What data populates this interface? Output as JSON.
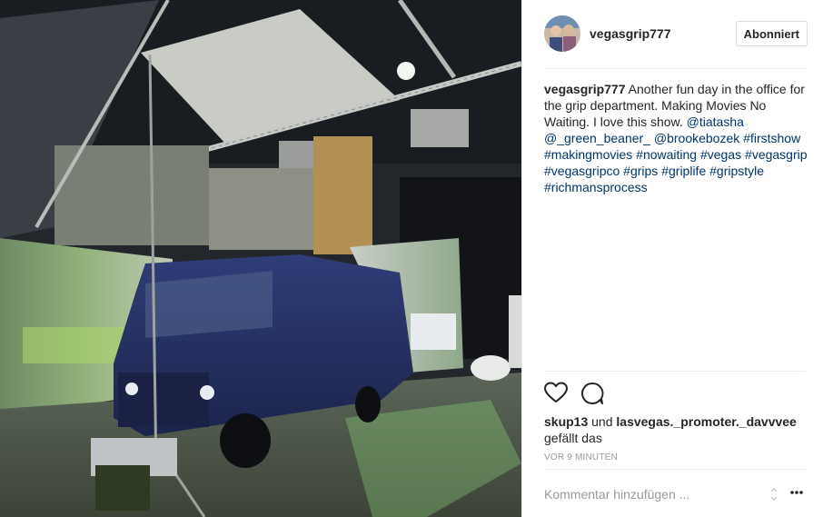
{
  "post": {
    "username": "vegasgrip777",
    "follow_label": "Abonniert",
    "caption": {
      "username": "vegasgrip777",
      "text": "Another fun day in the office for the grip department. Making Movies No Waiting. I love this show.",
      "tags": [
        "@tiatasha",
        "@_green_beaner_",
        "@brookebozek",
        "#firstshow",
        "#makingmovies",
        "#nowaiting",
        "#vegas",
        "#vegasgrip",
        "#vegasgripco",
        "#grips",
        "#griplife",
        "#gripstyle",
        "#richmansprocess"
      ]
    },
    "icons": {
      "like": "heart-icon",
      "comment": "comment-bubble-icon",
      "more": "more-options-icon"
    },
    "likes": {
      "user1": "skup13",
      "connector": "und",
      "user2": "lasvegas._promoter._davvvee",
      "suffix": "gefällt das"
    },
    "timestamp": "VOR 9 MINUTEN",
    "comment_placeholder": "Kommentar hinzufügen ..."
  },
  "colors": {
    "link": "#003569",
    "text": "#262626",
    "muted": "#999999",
    "border": "#efefef"
  }
}
